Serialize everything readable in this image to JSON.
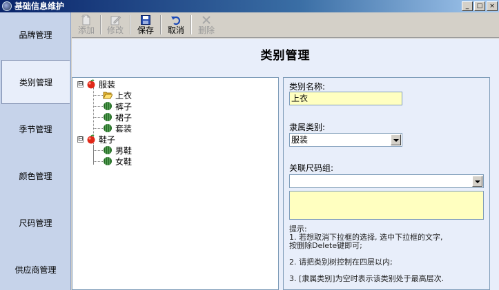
{
  "window": {
    "title": "基础信息维护",
    "buttons": {
      "minimize": "_",
      "maximize": "□",
      "close": "×"
    }
  },
  "nav": {
    "items": [
      {
        "label": "品牌管理",
        "active": false
      },
      {
        "label": "类别管理",
        "active": true
      },
      {
        "label": "季节管理",
        "active": false
      },
      {
        "label": "颜色管理",
        "active": false
      },
      {
        "label": "尺码管理",
        "active": false
      },
      {
        "label": "供应商管理",
        "active": false
      }
    ]
  },
  "toolbar": {
    "add": {
      "label": "添加",
      "enabled": false,
      "icon": "add-document-icon"
    },
    "edit": {
      "label": "修改",
      "enabled": false,
      "icon": "edit-icon"
    },
    "save": {
      "label": "保存",
      "enabled": true,
      "icon": "save-icon"
    },
    "cancel": {
      "label": "取消",
      "enabled": true,
      "icon": "undo-icon"
    },
    "delete": {
      "label": "删除",
      "enabled": false,
      "icon": "delete-x-icon"
    }
  },
  "page": {
    "title": "类别管理"
  },
  "tree": {
    "nodes": [
      {
        "label": "服装",
        "icon": "red-apple-icon",
        "expanded": true,
        "expander": "⊟",
        "children": [
          {
            "label": "上衣",
            "icon": "open-folder-icon"
          },
          {
            "label": "裤子",
            "icon": "watermelon-icon"
          },
          {
            "label": "裙子",
            "icon": "watermelon-icon"
          },
          {
            "label": "套装",
            "icon": "watermelon-icon"
          }
        ]
      },
      {
        "label": "鞋子",
        "icon": "red-apple-icon",
        "expanded": true,
        "expander": "⊟",
        "children": [
          {
            "label": "男鞋",
            "icon": "watermelon-icon"
          },
          {
            "label": "女鞋",
            "icon": "watermelon-icon"
          }
        ]
      }
    ]
  },
  "form": {
    "name_label": "类别名称:",
    "name_value": "上衣",
    "parent_label": "隶属类别:",
    "parent_value": "服装",
    "sizegroup_label": "关联尺码组:",
    "sizegroup_value": "",
    "hints": [
      "提示:",
      "1. 若想取消下拉框的选择, 选中下拉框的文字,",
      "按删除Delete键即可;",
      "2. 请把类别树控制在四层以内;",
      "3. [隶属类别]为空时表示该类别处于最高层次."
    ]
  },
  "colors": {
    "nav_bg": "#c6d3ea",
    "content_bg": "#e8eefa",
    "input_highlight": "#ffffc0",
    "title_gradient_start": "#0a246a"
  }
}
